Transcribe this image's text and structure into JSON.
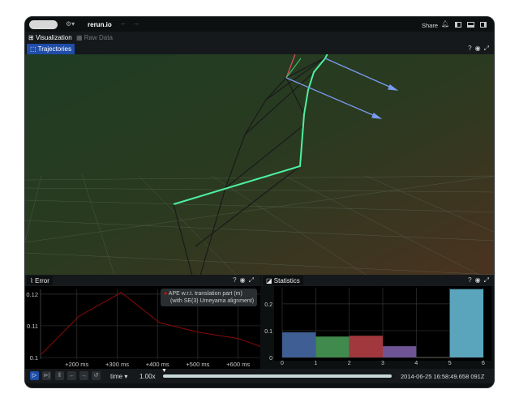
{
  "topbar": {
    "app_title": "rerun.io",
    "share_label": "Share",
    "back": "←",
    "forward": "→"
  },
  "tabs": [
    {
      "label": "Visualization",
      "active": true
    },
    {
      "label": "Raw Data",
      "active": false
    }
  ],
  "view3d": {
    "title": "Trajectories",
    "colors": {
      "trajectory": "#4ef0a0",
      "ground_truth": "#1a1a1a",
      "x_axis": "#e05060",
      "y_axis": "#40c060",
      "z_axis": "#7a9af0"
    }
  },
  "panel_icons": {
    "help": "?",
    "eye": "eye-icon",
    "maximize": "maximize-icon"
  },
  "error_panel": {
    "title": "Error",
    "legend": [
      "APE w.r.t. translation part (m)",
      "(with SE(3) Umeyama alignment)"
    ],
    "chart_data": {
      "type": "line",
      "series": [
        {
          "name": "APE w.r.t. translation part (m) (with SE(3) Umeyama alignment)",
          "color": "#8b0a0a",
          "x": [
            112,
            205,
            310,
            405,
            500,
            600,
            655
          ],
          "y": [
            0.101,
            0.113,
            0.1205,
            0.111,
            0.108,
            0.106,
            0.1035
          ]
        }
      ],
      "xticks": [
        "+200 ms",
        "+300 ms",
        "+400 ms",
        "+500 ms",
        "+600 ms"
      ],
      "xtick_values": [
        200,
        300,
        400,
        500,
        600
      ],
      "yticks": [
        "0.1",
        "0.11",
        "0.12"
      ],
      "ytick_values": [
        0.1,
        0.11,
        0.12
      ],
      "xlim": [
        110,
        655
      ],
      "ylim": [
        0.0995,
        0.1215
      ],
      "grid": true,
      "legend_placement": "top-right"
    }
  },
  "stats_panel": {
    "title": "Statistics",
    "chart_data": {
      "type": "bar",
      "bins": [
        0,
        1,
        2,
        3,
        4,
        5,
        6
      ],
      "values": [
        0.094,
        0.078,
        0.081,
        0.042,
        0.001,
        0.255
      ],
      "colors": [
        "#3e5e94",
        "#3f8a4c",
        "#a0383e",
        "#6e5494",
        "#7a7a6a",
        "#5aa4bc"
      ],
      "xticks": [
        "0",
        "1",
        "2",
        "3",
        "4",
        "5",
        "6"
      ],
      "yticks": [
        "0",
        "0.1",
        "0.2"
      ],
      "ylim": [
        0,
        0.26
      ],
      "grid": true
    }
  },
  "timebar": {
    "timeline": "time",
    "speed": "1.00x",
    "timestamp": "2014-06-25 16:58:49.658 091Z",
    "progress": 0
  }
}
